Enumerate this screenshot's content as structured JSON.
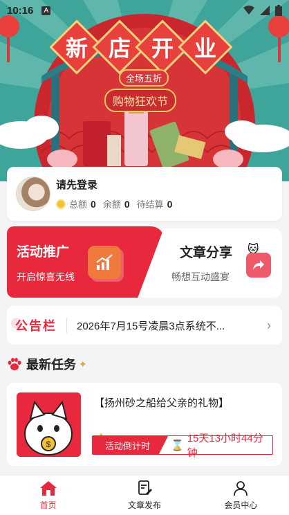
{
  "status_bar": {
    "time": "10:16",
    "badge": "A"
  },
  "banner": {
    "title_chars": [
      "新",
      "店",
      "开",
      "业"
    ],
    "subtitle_small": "全场五折",
    "subtitle_big": "购物狂欢节"
  },
  "user": {
    "name": "请先登录",
    "total_label": "总额",
    "total_value": "0",
    "balance_label": "余额",
    "balance_value": "0",
    "pending_label": "待结算",
    "pending_value": "0"
  },
  "promo": {
    "left_title": "活动推广",
    "left_desc": "开启惊喜无线",
    "right_title": "文章分享",
    "right_desc": "畅想互动盛宴"
  },
  "notice": {
    "label": "公告栏",
    "text": "2026年7月15号凌晨3点系统不..."
  },
  "tasks_section": {
    "title": "最新任务"
  },
  "task": {
    "title": "【扬州砂之船给父亲的礼物】",
    "countdown_label": "活动倒计时",
    "countdown_value": "15天13小时44分钟"
  },
  "nav": {
    "home": "首页",
    "publish": "文章发布",
    "member": "会员中心"
  },
  "colors": {
    "brand_red": "#e8283c",
    "banner_teal": "#3fa59a"
  }
}
